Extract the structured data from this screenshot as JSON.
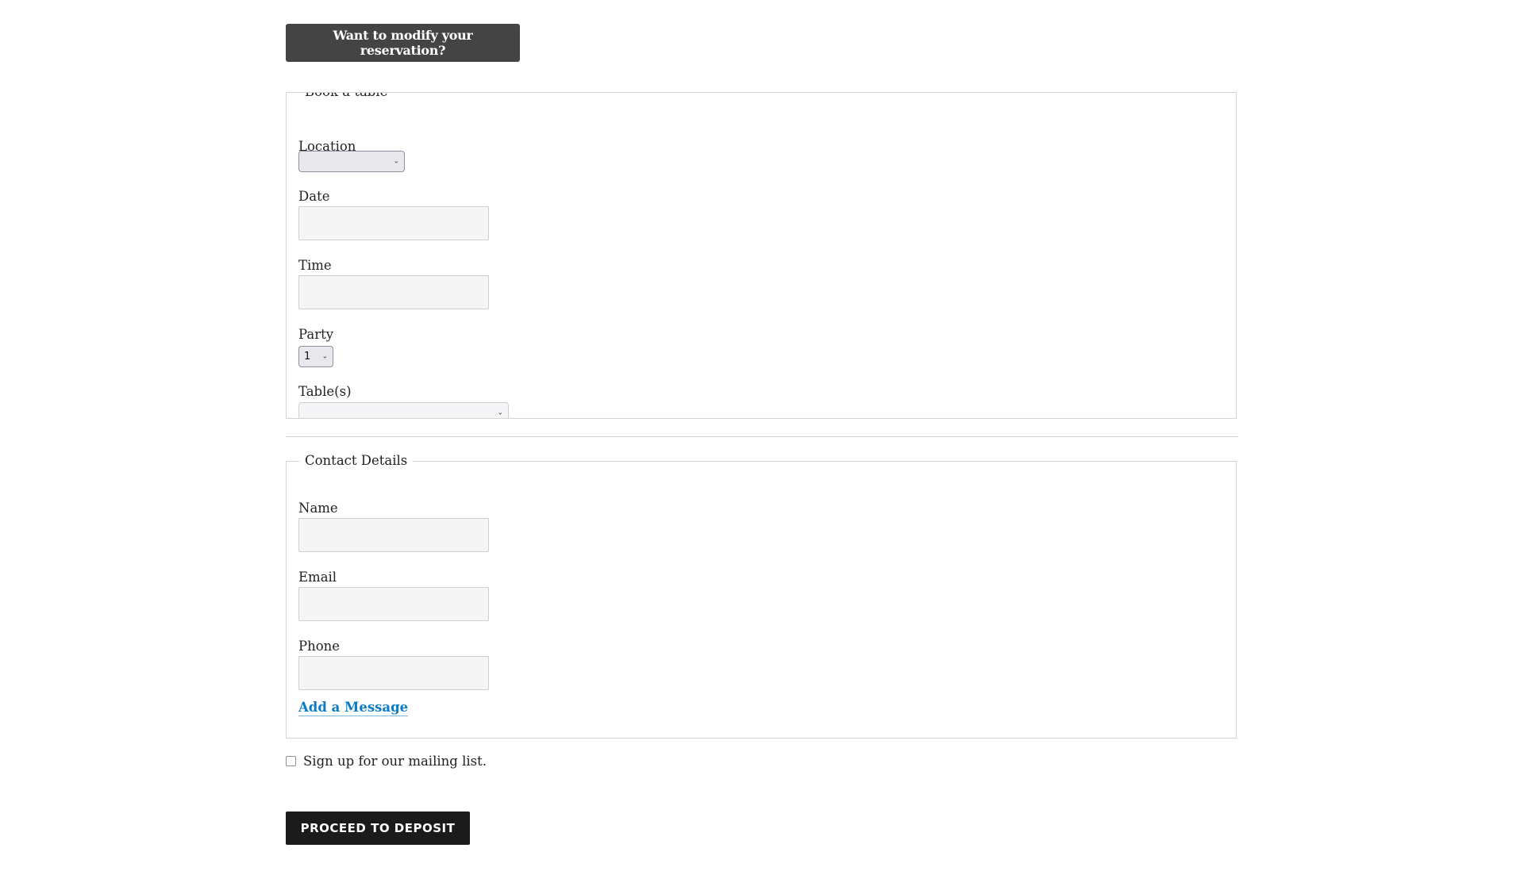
{
  "header": {
    "modify_button_label": "Want to modify your reservation?"
  },
  "booking": {
    "legend": "Book a table",
    "location": {
      "label": "Location",
      "selected": ""
    },
    "date": {
      "label": "Date",
      "value": "",
      "placeholder": ""
    },
    "time": {
      "label": "Time",
      "value": "",
      "placeholder": ""
    },
    "party": {
      "label": "Party",
      "selected": "1"
    },
    "tables": {
      "label": "Table(s)",
      "selected": ""
    }
  },
  "contact": {
    "legend": "Contact Details",
    "name": {
      "label": "Name",
      "value": "",
      "placeholder": ""
    },
    "email": {
      "label": "Email",
      "value": "",
      "placeholder": ""
    },
    "phone": {
      "label": "Phone",
      "value": "",
      "placeholder": ""
    },
    "add_message_link": "Add a Message"
  },
  "mailing_list": {
    "label": "Sign up for our mailing list.",
    "checked": false
  },
  "submit": {
    "label": "PROCEED TO DEPOSIT"
  },
  "icons": {
    "chevron": "⌄"
  },
  "colors": {
    "link": "#0a7cc4",
    "primary_button": "#1b1b1b",
    "secondary_button": "#444444",
    "border": "#d4d4d4"
  }
}
